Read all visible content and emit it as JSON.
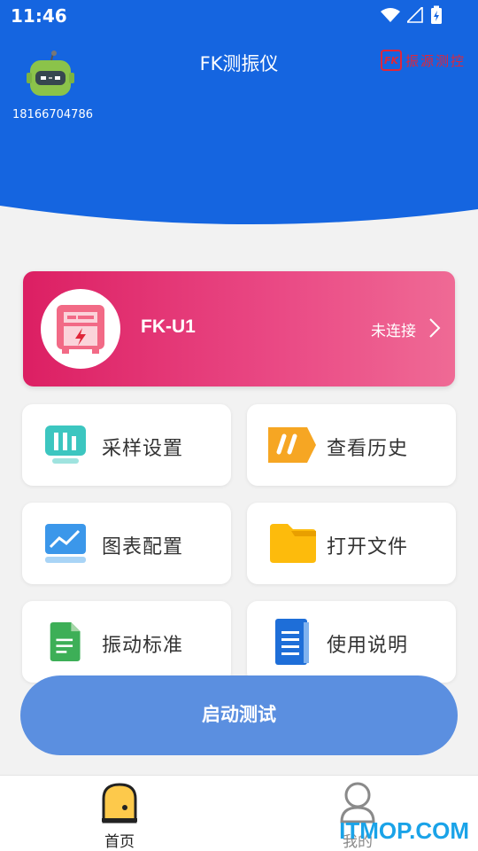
{
  "status_bar": {
    "time": "11:46"
  },
  "header": {
    "title": "FK测振仪",
    "phone": "18166704786",
    "brand_logo": "FK",
    "brand_text": "振源测控",
    "bg_color": "#1565e0"
  },
  "device": {
    "name": "FK-U1",
    "status": "未连接",
    "icon": "meter-icon"
  },
  "menu": [
    {
      "label": "采样设置",
      "icon": "sampling-bars-icon"
    },
    {
      "label": "查看历史",
      "icon": "history-tag-icon"
    },
    {
      "label": "图表配置",
      "icon": "chart-config-icon"
    },
    {
      "label": "打开文件",
      "icon": "folder-icon"
    },
    {
      "label": "振动标准",
      "icon": "document-green-icon"
    },
    {
      "label": "使用说明",
      "icon": "document-blue-icon"
    }
  ],
  "start_button": {
    "label": "启动测试"
  },
  "tabs": [
    {
      "label": "首页",
      "icon": "home-door-icon"
    },
    {
      "label": "我的",
      "icon": "user-icon"
    }
  ],
  "watermark": "ITMOP.COM"
}
